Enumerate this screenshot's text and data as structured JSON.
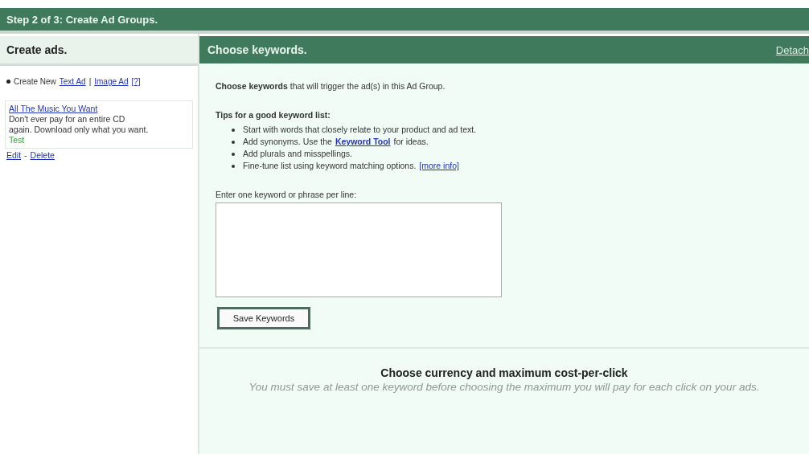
{
  "step_title": "Step 2 of 3: Create Ad Groups.",
  "left": {
    "title": "Create ads.",
    "create_new": {
      "label": "Create New",
      "links": [
        "Text Ad",
        "Image Ad"
      ],
      "separator": "|",
      "help": "[?]"
    },
    "ad": {
      "headline": "All The Music You Want",
      "line1": "Don't ever pay for an entire CD",
      "line2": "again. Download only what you want.",
      "url": "Test"
    },
    "actions": [
      "Edit",
      "Delete"
    ],
    "actions_separator": "-"
  },
  "right": {
    "title": "Choose keywords.",
    "detach": "Detach",
    "intro": "**Choose keywords** that will trigger the ad(s) in this Ad Group.",
    "tips_title": "Tips for a good keyword list:",
    "tips": [
      {
        "text": "Start with words that closely relate to your product and ad text."
      },
      {
        "text": "Add synonyms. Use the",
        "link": "Keyword Tool",
        "after": "for ideas."
      },
      {
        "text": "Add plurals and misspellings."
      },
      {
        "text": "Fine-tune list using keyword matching options.",
        "link": "[more info]"
      }
    ],
    "field_label": "Enter one keyword or phrase per line:",
    "save_button": "Save Keywords",
    "cpc_title": "Choose currency and maximum cost-per-click",
    "cpc_note": "You must save at least one keyword before choosing the maximum you will pay for each click on your ads."
  }
}
